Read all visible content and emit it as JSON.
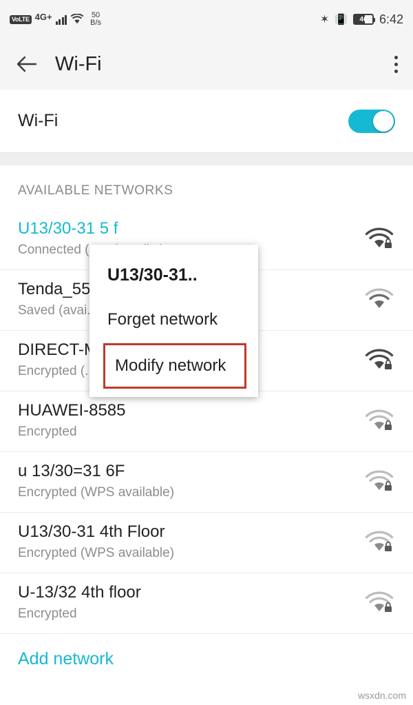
{
  "statusbar": {
    "volte_badge": "VoLTE",
    "network_type": "4G+",
    "data_speed_value": "50",
    "data_speed_unit": "B/s",
    "battery_percent": "46",
    "clock": "6:42",
    "icons": [
      "signal-bars-icon",
      "wifi-icon",
      "bluetooth-icon",
      "vibrate-icon",
      "battery-icon"
    ]
  },
  "appbar": {
    "back_icon": "back-arrow-icon",
    "title": "Wi-Fi",
    "overflow_icon": "overflow-menu-icon"
  },
  "wifi_toggle": {
    "label": "Wi-Fi",
    "state": "on",
    "accent_color": "#16b9d2"
  },
  "section": {
    "title": "AVAILABLE NETWORKS"
  },
  "networks": [
    {
      "name": "U13/30-31 5 f",
      "status": "Connected (good quality)",
      "connected": true,
      "secured": true,
      "strength": 4
    },
    {
      "name": "Tenda_55B...",
      "status": "Saved (avai...",
      "connected": false,
      "secured": false,
      "strength": 3
    },
    {
      "name": "DIRECT-M...",
      "status": "Encrypted (...",
      "connected": false,
      "secured": true,
      "strength": 4
    },
    {
      "name": "HUAWEI-8585",
      "status": "Encrypted",
      "connected": false,
      "secured": true,
      "strength": 2
    },
    {
      "name": "u 13/30=31 6F",
      "status": "Encrypted (WPS available)",
      "connected": false,
      "secured": true,
      "strength": 2
    },
    {
      "name": "U13/30-31 4th Floor",
      "status": "Encrypted (WPS available)",
      "connected": false,
      "secured": true,
      "strength": 2
    },
    {
      "name": "U-13/32 4th floor",
      "status": "Encrypted",
      "connected": false,
      "secured": true,
      "strength": 2
    }
  ],
  "add_network": {
    "label": "Add network"
  },
  "popup": {
    "title": "U13/30-31..",
    "items": [
      {
        "label": "Forget network",
        "highlighted": false
      },
      {
        "label": "Modify network",
        "highlighted": true
      }
    ],
    "highlight_color": "#c0392b"
  },
  "watermark": "wsxdn.com"
}
